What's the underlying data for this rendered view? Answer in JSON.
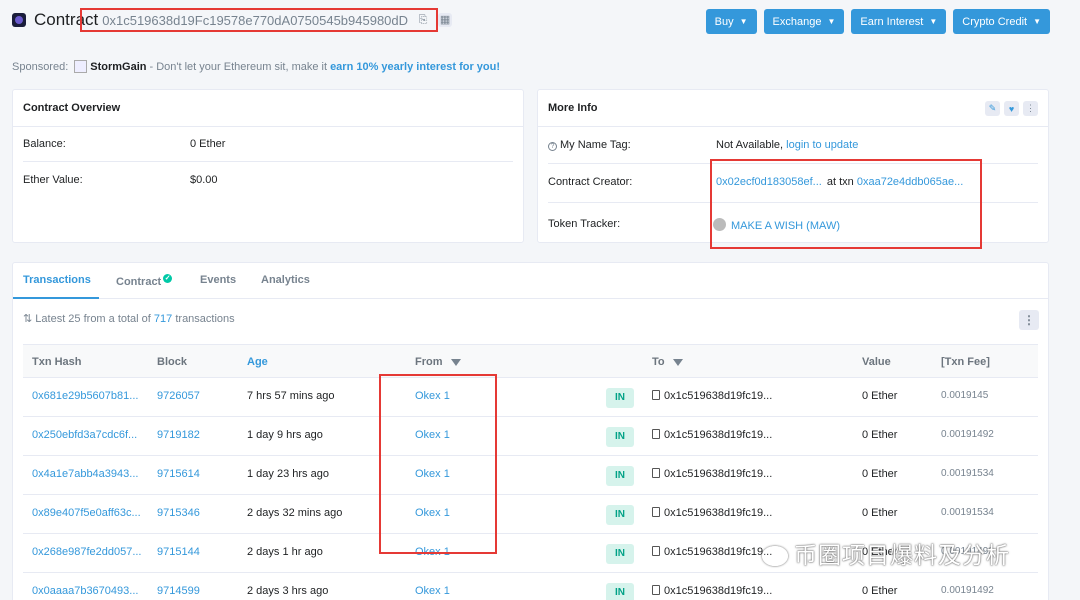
{
  "header": {
    "title": "Contract",
    "address": "0x1c519638d19Fc19578e770dA0750545b945980dD",
    "copy_icon": "copy-icon",
    "qr_icon": "qr-code-icon"
  },
  "top_buttons": [
    {
      "label": "Buy"
    },
    {
      "label": "Exchange"
    },
    {
      "label": "Earn Interest"
    },
    {
      "label": "Crypto Credit"
    }
  ],
  "sponsor": {
    "label": "Sponsored:",
    "name": "StormGain",
    "text": "- Don't let your Ethereum sit, make it",
    "highlight": "earn 10% yearly interest for you!"
  },
  "overview": {
    "title": "Contract Overview",
    "balance_label": "Balance:",
    "balance_value": "0 Ether",
    "ether_value_label": "Ether Value:",
    "ether_value": "$0.00"
  },
  "more_info": {
    "title": "More Info",
    "name_tag_label": "My Name Tag:",
    "name_tag_value": "Not Available,",
    "name_tag_link": "login to update",
    "creator_label": "Contract Creator:",
    "creator_address": "0x02ecf0d183058ef...",
    "creator_at": "at txn",
    "creator_txn": "0xaa72e4ddb065ae...",
    "token_label": "Token Tracker:",
    "token_value": "MAKE A WISH (MAW)"
  },
  "tabs": [
    {
      "label": "Transactions",
      "active": true
    },
    {
      "label": "Contract"
    },
    {
      "label": "Events"
    },
    {
      "label": "Analytics"
    }
  ],
  "latest": {
    "prefix": "Latest 25 from a total of",
    "count": "717",
    "suffix": "transactions"
  },
  "table": {
    "headers": [
      "Txn Hash",
      "Block",
      "Age",
      "From",
      "To",
      "Value",
      "[Txn Fee]"
    ],
    "rows": [
      {
        "hash": "0x681e29b5607b81...",
        "block": "9726057",
        "age": "7 hrs 57 mins ago",
        "from": "Okex 1",
        "dir": "IN",
        "to": "0x1c519638d19fc19...",
        "value": "0 Ether",
        "fee": "0.0019145"
      },
      {
        "hash": "0x250ebfd3a7cdc6f...",
        "block": "9719182",
        "age": "1 day 9 hrs ago",
        "from": "Okex 1",
        "dir": "IN",
        "to": "0x1c519638d19fc19...",
        "value": "0 Ether",
        "fee": "0.00191492"
      },
      {
        "hash": "0x4a1e7abb4a3943...",
        "block": "9715614",
        "age": "1 day 23 hrs ago",
        "from": "Okex 1",
        "dir": "IN",
        "to": "0x1c519638d19fc19...",
        "value": "0 Ether",
        "fee": "0.00191534"
      },
      {
        "hash": "0x89e407f5e0aff63c...",
        "block": "9715346",
        "age": "2 days 32 mins ago",
        "from": "Okex 1",
        "dir": "IN",
        "to": "0x1c519638d19fc19...",
        "value": "0 Ether",
        "fee": "0.00191534"
      },
      {
        "hash": "0x268e987fe2dd057...",
        "block": "9715144",
        "age": "2 days 1 hr ago",
        "from": "Okex 1",
        "dir": "IN",
        "to": "0x1c519638d19fc19...",
        "value": "0 Ether",
        "fee": "0.00191492"
      },
      {
        "hash": "0x0aaaa7b3670493...",
        "block": "9714599",
        "age": "2 days 3 hrs ago",
        "from": "Okex 1",
        "dir": "IN",
        "to": "0x1c519638d19fc19...",
        "value": "0 Ether",
        "fee": "0.00191492"
      }
    ]
  },
  "watermark": "币圈项目爆料及分析",
  "colors": {
    "accent": "#3498db",
    "annotation": "#e53935",
    "in_badge": "#00a186"
  }
}
